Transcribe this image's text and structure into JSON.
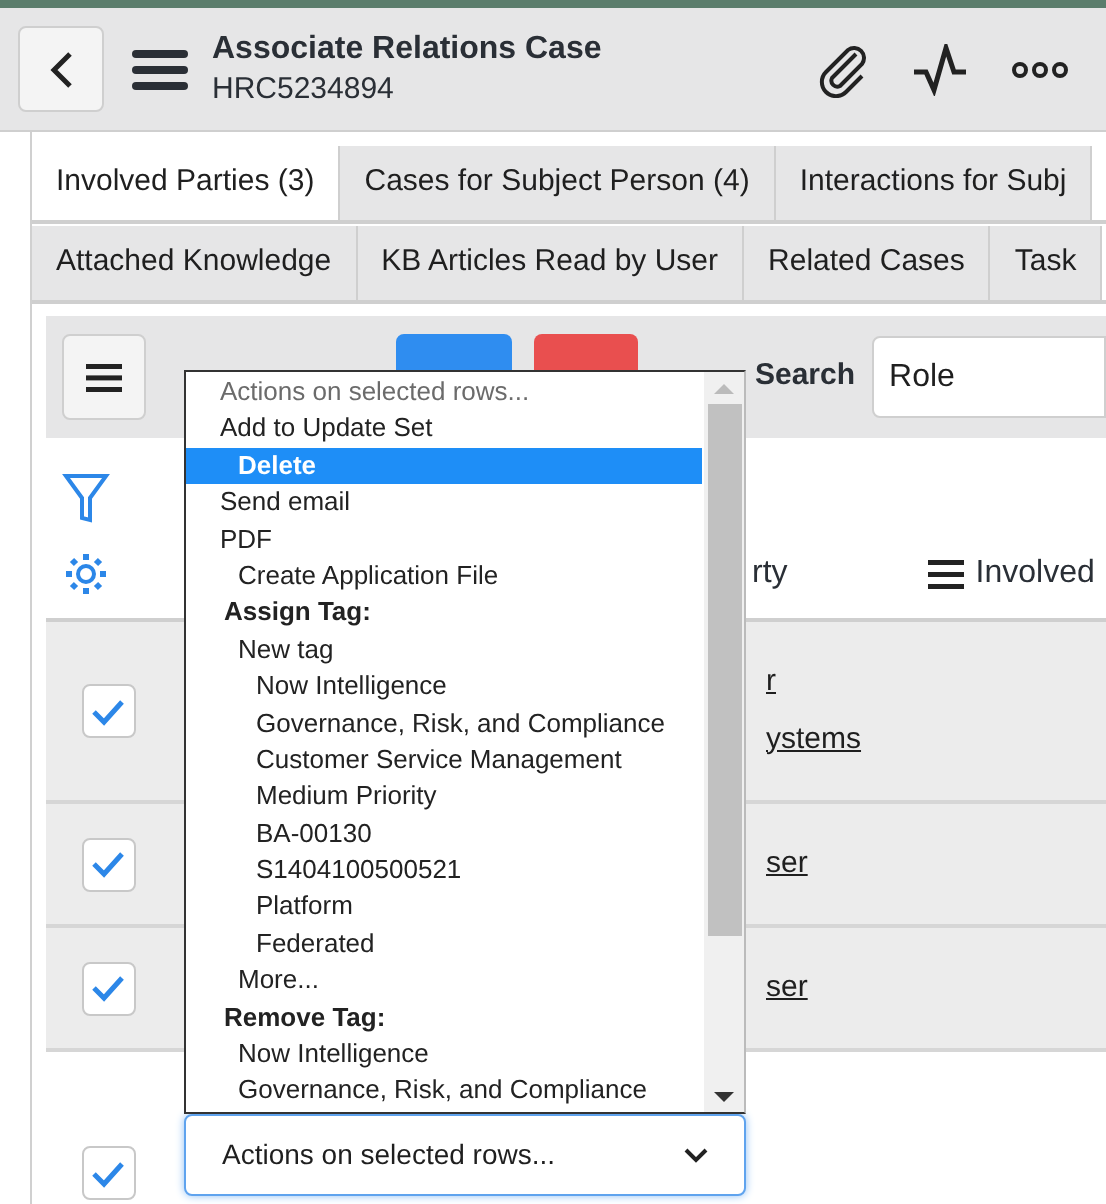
{
  "header": {
    "title": "Associate Relations Case",
    "number": "HRC5234894"
  },
  "tabs_row_1": [
    {
      "label": "Involved Parties (3)",
      "selected": true
    },
    {
      "label": "Cases for Subject Person (4)",
      "selected": false
    },
    {
      "label": "Interactions for Subj",
      "selected": false
    }
  ],
  "tabs_row_2": [
    {
      "label": "Attached Knowledge",
      "selected": false
    },
    {
      "label": "KB Articles Read by User",
      "selected": false
    },
    {
      "label": "Related Cases",
      "selected": false
    },
    {
      "label": "Task",
      "selected": false
    }
  ],
  "toolbar": {
    "search_label": "Search",
    "search_value": "Role"
  },
  "columns": [
    {
      "label": "rty",
      "kind": "plain"
    },
    {
      "label": "Involved",
      "kind": "menu"
    }
  ],
  "rows": [
    {
      "checked": true,
      "lines": [
        "r",
        "ystems"
      ]
    },
    {
      "checked": true,
      "lines": [
        "ser"
      ]
    },
    {
      "checked": true,
      "lines": [
        "ser"
      ]
    },
    {
      "checked": true,
      "lines": []
    }
  ],
  "actions_select": {
    "value": "Actions on selected rows...",
    "expanded": true
  },
  "actions_menu": [
    {
      "label": "Actions on selected rows...",
      "kind": "option",
      "disabled": true,
      "selected": false
    },
    {
      "label": "Add to Update Set",
      "kind": "option",
      "disabled": false,
      "selected": false,
      "children": [
        {
          "label": "Delete",
          "kind": "option",
          "disabled": false,
          "selected": true
        }
      ]
    },
    {
      "label": "Send email",
      "kind": "option",
      "disabled": false,
      "selected": false
    },
    {
      "label": "PDF",
      "kind": "option",
      "disabled": false,
      "selected": false,
      "children": [
        {
          "label": "Create Application File",
          "kind": "option",
          "disabled": false,
          "selected": false
        }
      ]
    },
    {
      "label": "Assign Tag:",
      "kind": "group",
      "children": [
        {
          "label": "New tag",
          "kind": "option",
          "disabled": false,
          "selected": false,
          "children": [
            {
              "label": "Now Intelligence",
              "kind": "option",
              "disabled": false,
              "selected": false
            },
            {
              "label": "Governance, Risk, and Compliance",
              "kind": "option",
              "disabled": false,
              "selected": false
            },
            {
              "label": "Customer Service Management",
              "kind": "option",
              "disabled": false,
              "selected": false
            },
            {
              "label": "Medium Priority",
              "kind": "option",
              "disabled": false,
              "selected": false
            },
            {
              "label": "BA-00130",
              "kind": "option",
              "disabled": false,
              "selected": false
            },
            {
              "label": "S1404100500521",
              "kind": "option",
              "disabled": false,
              "selected": false
            },
            {
              "label": "Platform",
              "kind": "option",
              "disabled": false,
              "selected": false
            },
            {
              "label": "Federated",
              "kind": "option",
              "disabled": false,
              "selected": false
            }
          ]
        },
        {
          "label": "More...",
          "kind": "option",
          "disabled": false,
          "selected": false
        }
      ]
    },
    {
      "label": "Remove Tag:",
      "kind": "group",
      "children": [
        {
          "label": "Now Intelligence",
          "kind": "option",
          "disabled": false,
          "selected": false
        },
        {
          "label": "Governance, Risk, and Compliance",
          "kind": "option",
          "disabled": false,
          "selected": false
        }
      ]
    }
  ]
}
